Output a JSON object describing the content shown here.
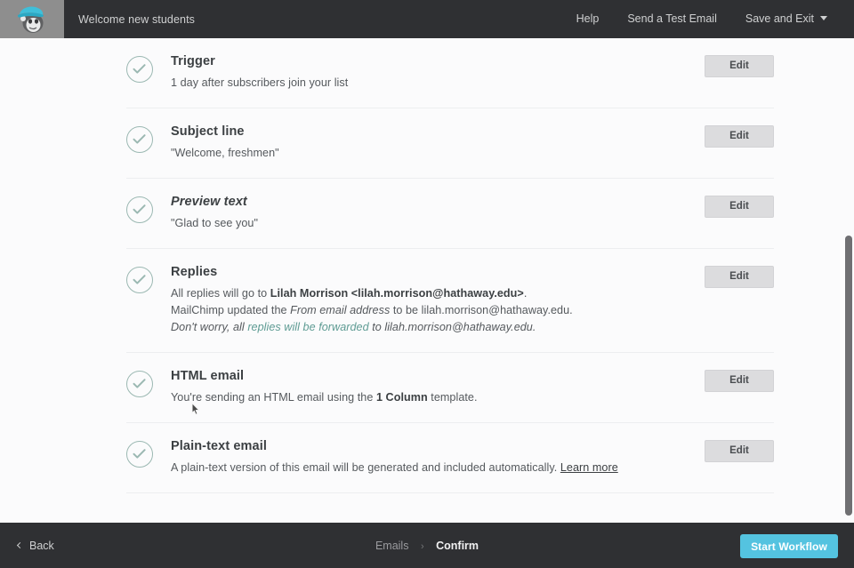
{
  "topbar": {
    "logo_icon": "mailchimp-freddie-logo",
    "campaign_title": "Welcome new students",
    "links": [
      {
        "label": "Help",
        "name": "help-link"
      },
      {
        "label": "Send a Test Email",
        "name": "send-test-email-link"
      },
      {
        "label": "Save and Exit",
        "name": "save-and-exit-menu",
        "caret": true
      }
    ]
  },
  "sections": [
    {
      "status_icon": "check-circle-icon",
      "title": "Trigger",
      "title_italic": false,
      "desc_lines": [
        [
          {
            "t": "1 day after subscribers join your list",
            "s": "n"
          }
        ]
      ],
      "edit_label": "Edit"
    },
    {
      "status_icon": "check-circle-icon",
      "title": "Subject line",
      "title_italic": false,
      "desc_lines": [
        [
          {
            "t": "\"Welcome, freshmen\"",
            "s": "n"
          }
        ]
      ],
      "edit_label": "Edit"
    },
    {
      "status_icon": "check-circle-icon",
      "title": "Preview text",
      "title_italic": true,
      "desc_lines": [
        [
          {
            "t": "\"Glad to see you\"",
            "s": "n"
          }
        ]
      ],
      "edit_label": "Edit"
    },
    {
      "status_icon": "check-circle-icon",
      "title": "Replies",
      "title_italic": false,
      "desc_lines": [
        [
          {
            "t": "All replies will go to ",
            "s": "n"
          },
          {
            "t": "Lilah Morrison <lilah.morrison@hathaway.edu>",
            "s": "b"
          },
          {
            "t": ".",
            "s": "n"
          }
        ],
        [
          {
            "t": "MailChimp updated the ",
            "s": "n"
          },
          {
            "t": "From email address",
            "s": "i"
          },
          {
            "t": " to be lilah.morrison@hathaway.edu.",
            "s": "n"
          }
        ],
        [
          {
            "t": "Don't worry, all ",
            "s": "i"
          },
          {
            "t": "replies will be forwarded",
            "s": "teal"
          },
          {
            "t": " to lilah.morrison@hathaway.edu.",
            "s": "i"
          }
        ]
      ],
      "edit_label": "Edit"
    },
    {
      "status_icon": "check-circle-icon",
      "title": "HTML email",
      "title_italic": false,
      "desc_lines": [
        [
          {
            "t": "You're sending an HTML email using the ",
            "s": "n"
          },
          {
            "t": "1 Column",
            "s": "b"
          },
          {
            "t": " template.",
            "s": "n"
          }
        ]
      ],
      "edit_label": "Edit"
    },
    {
      "status_icon": "check-circle-icon",
      "title": "Plain-text email",
      "title_italic": false,
      "desc_lines": [
        [
          {
            "t": "A plain-text version of this email will be generated and included automatically. ",
            "s": "n"
          },
          {
            "t": "Learn more",
            "s": "learn"
          }
        ]
      ],
      "edit_label": "Edit"
    }
  ],
  "footer": {
    "back_label": "Back",
    "back_icon": "chevron-left-icon",
    "breadcrumb": {
      "parent": "Emails",
      "separator": "›",
      "current": "Confirm"
    },
    "primary_button": "Start Workflow"
  },
  "colors": {
    "topbar_bg": "#2f3033",
    "page_bg": "#fbfbfc",
    "check_stroke": "#9bb8b2",
    "accent_link": "#5f9c94",
    "primary_button": "#54c3e0",
    "edit_button": "#dcdcde",
    "scrollbar_thumb": "#6f6f72"
  },
  "scrollbar": {
    "name": "vertical-scrollbar"
  }
}
